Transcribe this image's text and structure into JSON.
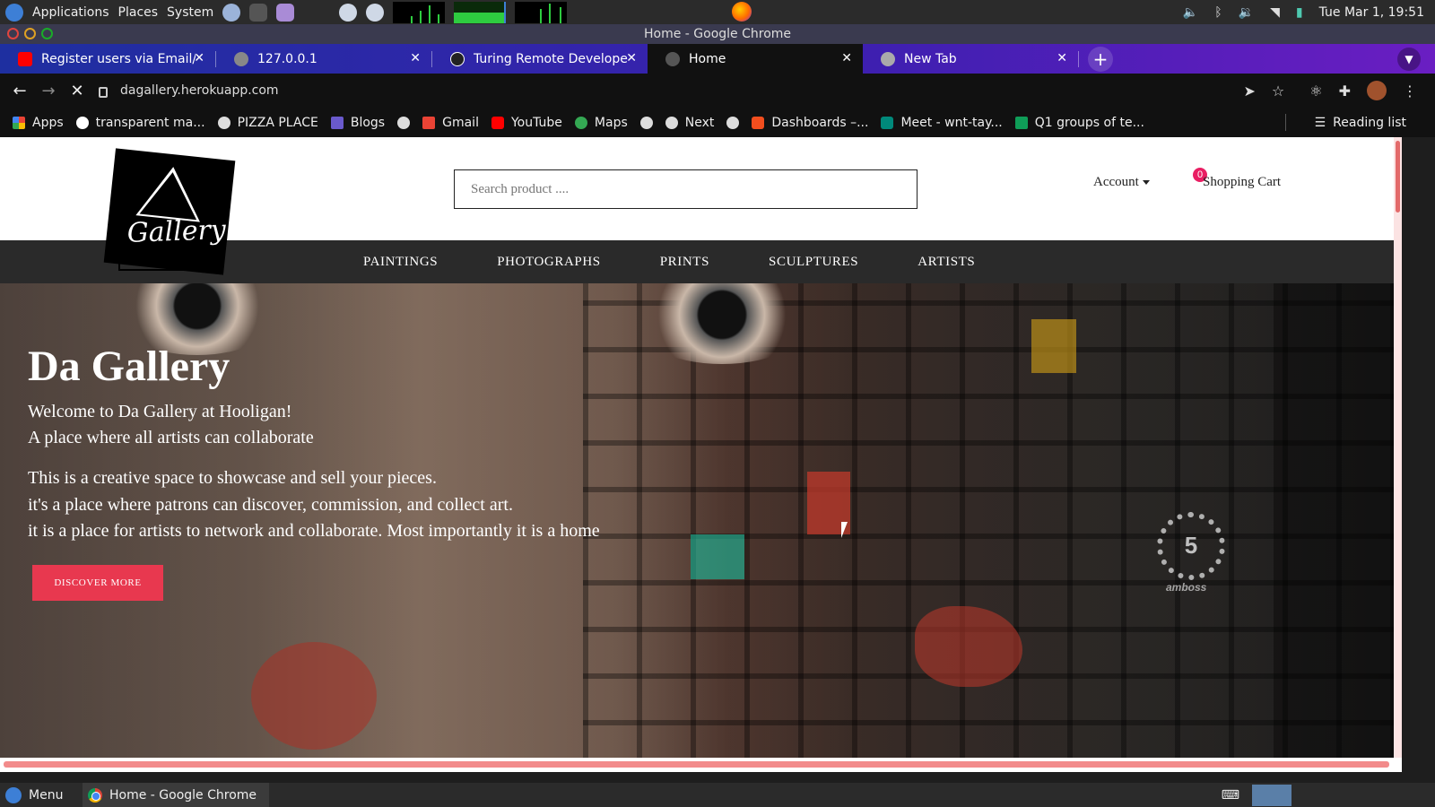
{
  "os_panel": {
    "menu": [
      "Applications",
      "Places",
      "System"
    ],
    "clock": "Tue Mar 1, 19:51"
  },
  "window": {
    "title": "Home - Google Chrome"
  },
  "tabs": [
    {
      "label": "Register users via Email/ S",
      "favicon_color": "#ff0000"
    },
    {
      "label": "127.0.0.1",
      "favicon_color": "#888888"
    },
    {
      "label": "Turing Remote Developer",
      "favicon_color": "#222222"
    },
    {
      "label": "Home",
      "favicon_color": "#555555",
      "active": true
    },
    {
      "label": "New Tab",
      "favicon_color": "#aaaaaa"
    }
  ],
  "toolbar": {
    "url": "dagallery.herokuapp.com"
  },
  "bookmarks": [
    {
      "label": "Apps",
      "icon": "apps-grid-icon",
      "color": "#e74c3c"
    },
    {
      "label": "transparent ma...",
      "icon": "google-icon",
      "color": "#ffffff"
    },
    {
      "label": "PIZZA PLACE",
      "icon": "globe-icon",
      "color": "#dddddd"
    },
    {
      "label": "Blogs",
      "icon": "blogs-icon",
      "color": "#6a5acd"
    },
    {
      "label": "",
      "icon": "globe-icon",
      "color": "#dddddd"
    },
    {
      "label": "Gmail",
      "icon": "gmail-icon",
      "color": "#ea4335"
    },
    {
      "label": "YouTube",
      "icon": "youtube-icon",
      "color": "#ff0000"
    },
    {
      "label": "Maps",
      "icon": "maps-icon",
      "color": "#34a853"
    },
    {
      "label": "",
      "icon": "globe-icon",
      "color": "#dddddd"
    },
    {
      "label": "Next",
      "icon": "globe-icon",
      "color": "#dddddd"
    },
    {
      "label": "",
      "icon": "globe-icon",
      "color": "#dddddd"
    },
    {
      "label": "Dashboards –...",
      "icon": "figma-icon",
      "color": "#f24e1e"
    },
    {
      "label": "Meet - wnt-tay...",
      "icon": "meet-icon",
      "color": "#00897b"
    },
    {
      "label": "Q1 groups of te...",
      "icon": "sheets-icon",
      "color": "#0f9d58"
    }
  ],
  "reading_list": "Reading list",
  "site": {
    "logo_text": "Gallery",
    "search_placeholder": "Search product ....",
    "account_label": "Account",
    "cart_count": "0",
    "cart_label": "Shopping Cart",
    "categories": [
      "PAINTINGS",
      "PHOTOGRAPHS",
      "PRINTS",
      "SCULPTURES",
      "ARTISTS"
    ],
    "hero": {
      "title": "Da Gallery",
      "line1": "Welcome to Da Gallery at Hooligan!",
      "line2": "A place where all artists can collaborate",
      "line3": "This is a creative space to showcase and sell your pieces.",
      "line4": "it's a place where patrons can discover, commission, and collect art.",
      "line5": "it is a place for artists to network and collaborate. Most importantly it is a home",
      "button": "DISCOVER MORE",
      "emblem_number": "5",
      "emblem_text": "amboss"
    }
  },
  "taskbar": {
    "menu_label": "Menu",
    "task_label": "Home - Google Chrome"
  }
}
